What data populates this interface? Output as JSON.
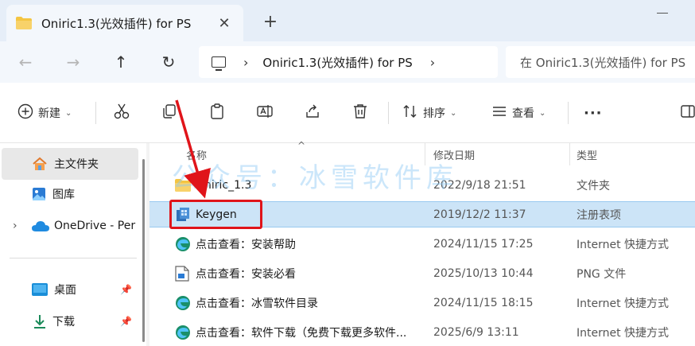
{
  "window": {
    "tab_title": "Oniric1.3(光效插件) for PS",
    "close_glyph": "✕",
    "new_tab_glyph": "+"
  },
  "nav": {
    "back_glyph": "←",
    "forward_glyph": "→",
    "up_glyph": "↑",
    "refresh_glyph": "↻",
    "chevron": "›",
    "path": "Oniric1.3(光效插件) for PS",
    "search_placeholder": "在 Oniric1.3(光效插件) for PS"
  },
  "toolbar": {
    "new_label": "新建",
    "sort_label": "排序",
    "view_label": "查看",
    "more_glyph": "···",
    "chev_glyph": "⌄"
  },
  "sidebar": {
    "items": [
      {
        "label": "主文件夹"
      },
      {
        "label": "图库"
      },
      {
        "label": "OneDrive - Per"
      },
      {
        "label": "桌面"
      },
      {
        "label": "下载"
      }
    ],
    "expand_glyph": "›",
    "pin_glyph": "📌"
  },
  "filelist": {
    "columns": {
      "name": "名称",
      "date": "修改日期",
      "type": "类型"
    },
    "sort_caret": "^",
    "rows": [
      {
        "name": "Oniric_1.3",
        "date": "2022/9/18 21:51",
        "type": "文件夹",
        "icon": "folder-icon"
      },
      {
        "name": "Keygen",
        "date": "2019/12/2 11:37",
        "type": "注册表项",
        "icon": "registry-icon"
      },
      {
        "name": "点击查看：安装帮助",
        "date": "2024/11/15 17:25",
        "type": "Internet 快捷方式",
        "icon": "edge-icon"
      },
      {
        "name": "点击查看：安装必看",
        "date": "2025/10/13 10:44",
        "type": "PNG 文件",
        "icon": "image-file-icon"
      },
      {
        "name": "点击查看：冰雪软件目录",
        "date": "2024/11/15 18:15",
        "type": "Internet 快捷方式",
        "icon": "edge-icon"
      },
      {
        "name": "点击查看：软件下载（免费下载更多软件...",
        "date": "2025/6/9 13:11",
        "type": "Internet 快捷方式",
        "icon": "edge-icon"
      }
    ]
  },
  "watermark": "公众号：冰雪软件库",
  "colors": {
    "selection": "#cce4f7",
    "annotation_red": "#e0141a",
    "folder_yellow": "#f4c542",
    "accent_blue": "#0a64c8"
  }
}
